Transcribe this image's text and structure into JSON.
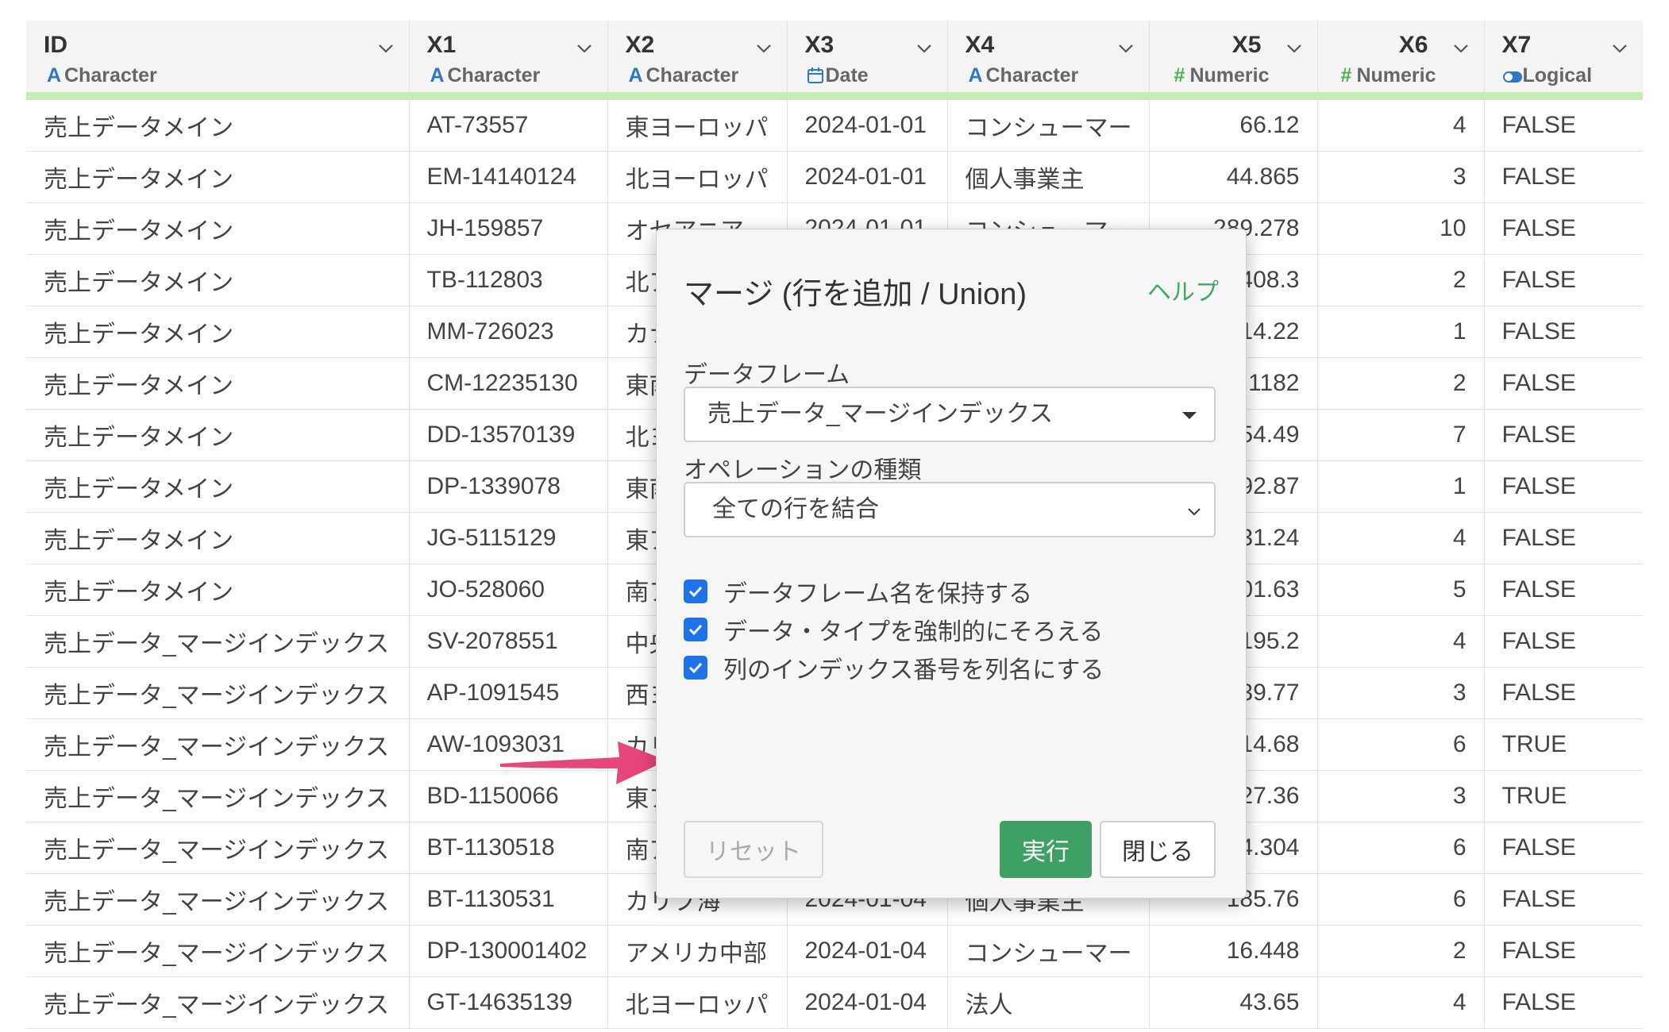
{
  "columns": [
    {
      "name": "ID",
      "type": "Character",
      "type_icon": "character-icon"
    },
    {
      "name": "X1",
      "type": "Character",
      "type_icon": "character-icon"
    },
    {
      "name": "X2",
      "type": "Character",
      "type_icon": "character-icon"
    },
    {
      "name": "X3",
      "type": "Date",
      "type_icon": "calendar-icon"
    },
    {
      "name": "X4",
      "type": "Character",
      "type_icon": "character-icon"
    },
    {
      "name": "X5",
      "type": "Numeric",
      "type_icon": "numeric-icon"
    },
    {
      "name": "X6",
      "type": "Numeric",
      "type_icon": "numeric-icon"
    },
    {
      "name": "X7",
      "type": "Logical",
      "type_icon": "logical-toggle-icon"
    }
  ],
  "rows": [
    [
      "売上データメイン",
      "AT-73557",
      "東ヨーロッパ",
      "2024-01-01",
      "コンシューマー",
      "66.12",
      "4",
      "FALSE"
    ],
    [
      "売上データメイン",
      "EM-14140124",
      "北ヨーロッパ",
      "2024-01-01",
      "個人事業主",
      "44.865",
      "3",
      "FALSE"
    ],
    [
      "売上データメイン",
      "JH-159857",
      "オセアニア",
      "2024-01-01",
      "コンシューマー",
      "289.278",
      "10",
      "FALSE"
    ],
    [
      "売上データメイン",
      "TB-112803",
      "北ア",
      "",
      "",
      "408.3",
      "2",
      "FALSE"
    ],
    [
      "売上データメイン",
      "MM-726023",
      "カナ",
      "",
      "",
      "14.22",
      "1",
      "FALSE"
    ],
    [
      "売上データメイン",
      "CM-12235130",
      "東南",
      "",
      "",
      "1182",
      "2",
      "FALSE"
    ],
    [
      "売上データメイン",
      "DD-13570139",
      "北ヨ",
      "",
      "",
      "54.49",
      "7",
      "FALSE"
    ],
    [
      "売上データメイン",
      "DP-1339078",
      "東南",
      "",
      "",
      "92.87",
      "1",
      "FALSE"
    ],
    [
      "売上データメイン",
      "JG-5115129",
      "東ア",
      "",
      "",
      "31.24",
      "4",
      "FALSE"
    ],
    [
      "売上データメイン",
      "JO-528060",
      "南ア",
      "",
      "",
      "01.63",
      "5",
      "FALSE"
    ],
    [
      "売上データ_マージインデックス",
      "SV-2078551",
      "中央",
      "",
      "",
      "195.2",
      "4",
      "FALSE"
    ],
    [
      "売上データ_マージインデックス",
      "AP-1091545",
      "西ヨ",
      "",
      "",
      "39.77",
      "3",
      "FALSE"
    ],
    [
      "売上データ_マージインデックス",
      "AW-1093031",
      "カリ",
      "",
      "",
      "14.68",
      "6",
      "TRUE"
    ],
    [
      "売上データ_マージインデックス",
      "BD-1150066",
      "東ア",
      "",
      "",
      "27.36",
      "3",
      "TRUE"
    ],
    [
      "売上データ_マージインデックス",
      "BT-1130518",
      "南ア",
      "",
      "",
      "4.304",
      "6",
      "FALSE"
    ],
    [
      "売上データ_マージインデックス",
      "BT-1130531",
      "カリブ海",
      "2024-01-04",
      "個人事業主",
      "185.76",
      "6",
      "FALSE"
    ],
    [
      "売上データ_マージインデックス",
      "DP-130001402",
      "アメリカ中部",
      "2024-01-04",
      "コンシューマー",
      "16.448",
      "2",
      "FALSE"
    ],
    [
      "売上データ_マージインデックス",
      "GT-14635139",
      "北ヨーロッパ",
      "2024-01-04",
      "法人",
      "43.65",
      "4",
      "FALSE"
    ]
  ],
  "dialog": {
    "title": "マージ (行を追加 / Union)",
    "help": "ヘルプ",
    "dataframe_label": "データフレーム",
    "dataframe_value": "売上データ_マージインデックス",
    "operation_label": "オペレーションの種類",
    "operation_value": "全ての行を結合",
    "checks": [
      {
        "label": "データフレーム名を保持する",
        "checked": true
      },
      {
        "label": "データ・タイプを強制的にそろえる",
        "checked": true
      },
      {
        "label": "列のインデックス番号を列名にする",
        "checked": true
      }
    ],
    "reset": "リセット",
    "run": "実行",
    "close": "閉じる"
  },
  "colors": {
    "header_accent": "#c4edb5",
    "run_button": "#3fa066",
    "help_link": "#43a96a",
    "checkbox": "#1f73e8",
    "annotation_arrow": "#e8457a"
  }
}
